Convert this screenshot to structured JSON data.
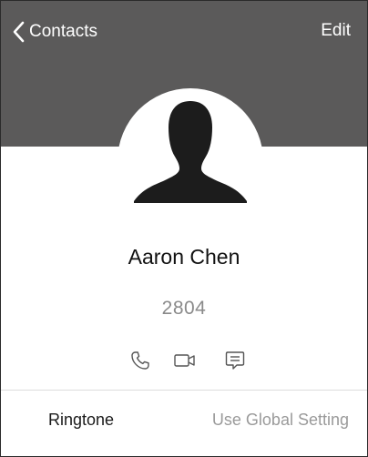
{
  "header": {
    "back_label": "Contacts",
    "edit_label": "Edit",
    "background_color": "#5b5a5a"
  },
  "contact": {
    "name": "Aaron Chen",
    "number": "2804",
    "avatar_icon": "person-silhouette-icon"
  },
  "actions": [
    {
      "icon": "phone-icon"
    },
    {
      "icon": "video-camera-icon"
    },
    {
      "icon": "message-icon"
    }
  ],
  "settings": {
    "ringtone_label": "Ringtone",
    "ringtone_value": "Use Global Setting"
  }
}
